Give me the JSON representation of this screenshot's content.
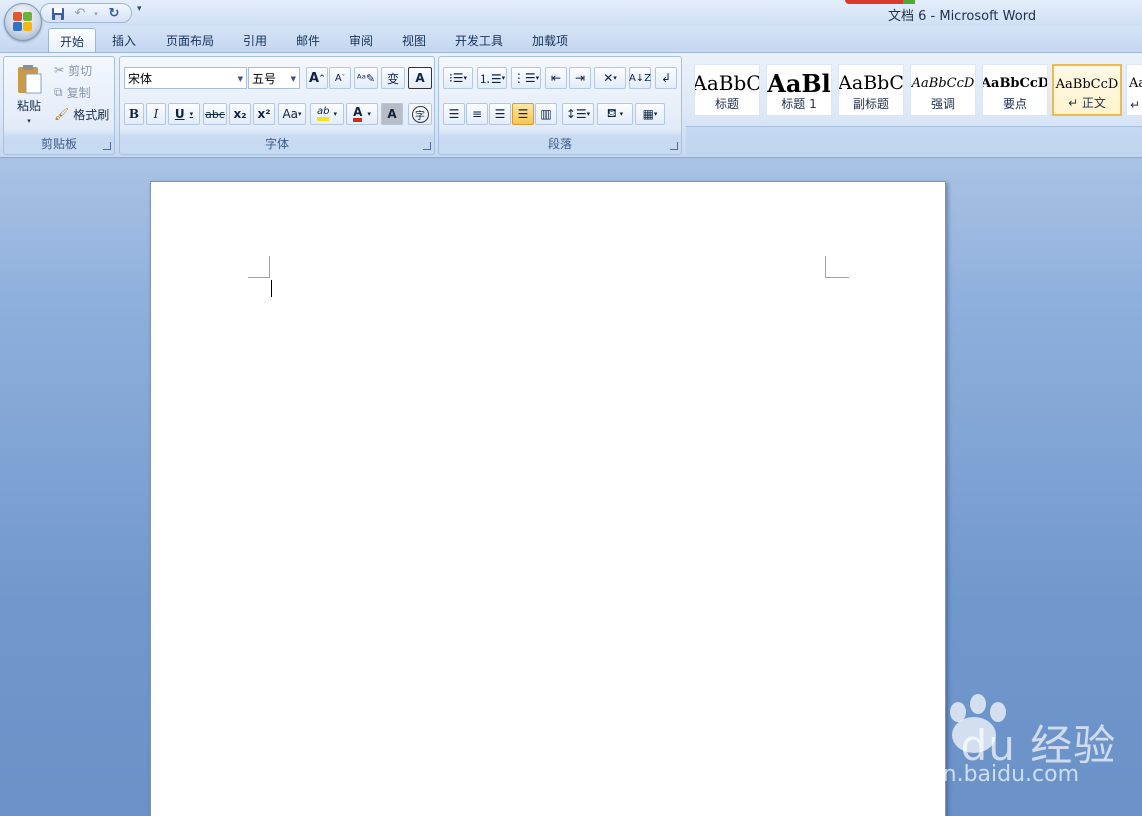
{
  "window": {
    "title": "文档 6 - Microsoft Word"
  },
  "quick_access": {
    "items": [
      "save-icon",
      "undo-icon",
      "redo-icon"
    ],
    "more": "▾"
  },
  "tabs": [
    {
      "label": "开始",
      "active": true
    },
    {
      "label": "插入"
    },
    {
      "label": "页面布局"
    },
    {
      "label": "引用"
    },
    {
      "label": "邮件"
    },
    {
      "label": "审阅"
    },
    {
      "label": "视图"
    },
    {
      "label": "开发工具"
    },
    {
      "label": "加载项"
    }
  ],
  "clipboard": {
    "paste": "粘贴",
    "cut": "剪切",
    "copy": "复制",
    "format_painter": "格式刷",
    "group_label": "剪贴板"
  },
  "font": {
    "name": "宋体",
    "size": "五号",
    "group_label": "字体",
    "grow": "A",
    "shrink": "A",
    "clear": "A",
    "phonetic": "变",
    "border": "A",
    "bold": "B",
    "italic": "I",
    "underline": "U",
    "strike": "abc",
    "sub": "x₂",
    "sup": "x²",
    "case": "Aa",
    "highlight": "ab",
    "color": "A",
    "shade": "A",
    "enclose": "字"
  },
  "paragraph": {
    "group_label": "段落"
  },
  "styles": [
    {
      "sample": "AaBbC",
      "name": "标题"
    },
    {
      "sample": "AaBl",
      "name": "标题 1"
    },
    {
      "sample": "AaBbC",
      "name": "副标题"
    },
    {
      "sample": "AaBbCcD",
      "name": "强调"
    },
    {
      "sample": "AaBbCcD",
      "name": "要点"
    },
    {
      "sample": "AaBbCcD",
      "name": "↵ 正文",
      "selected": true
    },
    {
      "sample": "Aa",
      "name": "↵"
    }
  ],
  "watermark": {
    "brand": "Bai du 经验",
    "url": "jingyan.baidu.com"
  },
  "colors": {
    "highlight": "#f7e319",
    "font_color": "#d52a16",
    "accent": "#f2b84b"
  }
}
